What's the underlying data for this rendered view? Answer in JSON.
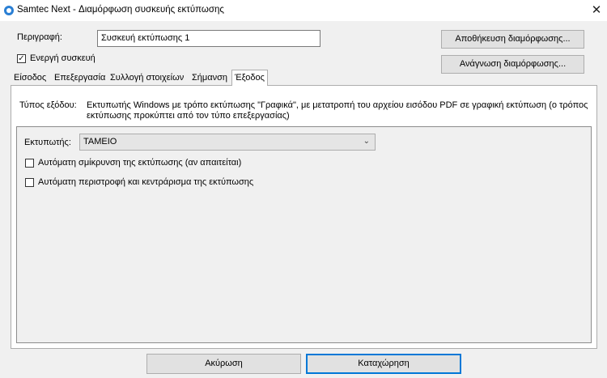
{
  "window": {
    "title": "Samtec Next - Διαμόρφωση συσκευής εκτύπωσης",
    "close_glyph": "✕"
  },
  "form": {
    "description_label": "Περιγραφή:",
    "description_value": "Συσκευή εκτύπωσης 1",
    "active_device_label": "Ενεργή συσκευή",
    "active_device_checked": true
  },
  "buttons": {
    "save_config": "Αποθήκευση διαμόρφωσης...",
    "load_config": "Ανάγνωση διαμόρφωσης...",
    "cancel": "Ακύρωση",
    "submit": "Καταχώρηση"
  },
  "tabs": [
    {
      "label": "Είσοδος",
      "active": false
    },
    {
      "label": "Επεξεργασία",
      "active": false
    },
    {
      "label": "Συλλογή στοιχείων",
      "active": false
    },
    {
      "label": "Σήμανση",
      "active": false
    },
    {
      "label": "Έξοδος",
      "active": true
    }
  ],
  "output": {
    "type_label": "Τύπος εξόδου:",
    "type_description_line1": "Εκτυπωτής Windows με τρόπο εκτύπωσης \"Γραφικά\", με μετατροπή του αρχείου εισόδου PDF σε γραφική εκτύπωση (ο τρόπος",
    "type_description_line2": "εκτύπωσης προκύπτει από τον τύπο επεξεργασίας)",
    "printer_label": "Εκτυπωτής:",
    "printer_value": "ΤΑΜΕΙΟ",
    "auto_shrink_label": "Αυτόματη σμίκρυνση της εκτύπωσης (αν απαιτείται)",
    "auto_shrink_checked": false,
    "auto_rotate_label": "Αυτόματη περιστροφή και κεντράρισμα της εκτύπωσης",
    "auto_rotate_checked": false
  },
  "colors": {
    "accent": "#0078d7",
    "window_bg": "#f0f0f0"
  }
}
